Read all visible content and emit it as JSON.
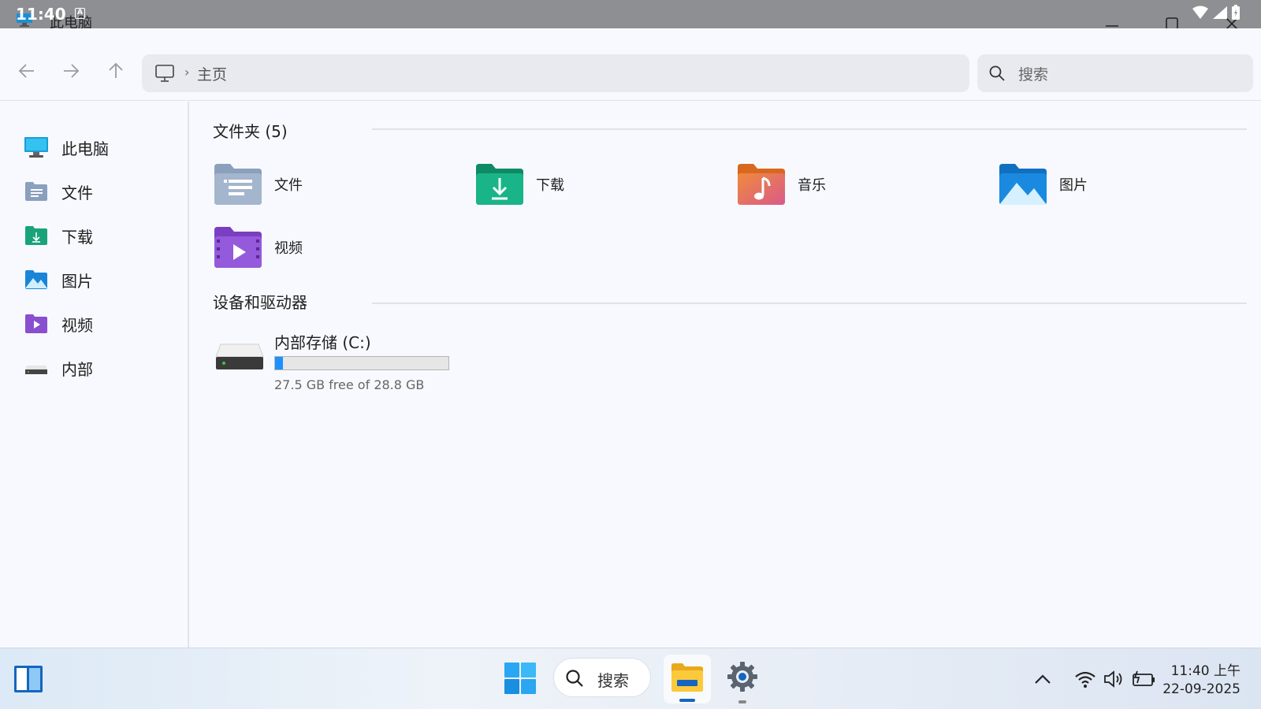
{
  "status_bar": {
    "time": "11:40",
    "notification_letter": "A"
  },
  "window": {
    "title": "此电脑"
  },
  "address": {
    "separator": "›",
    "path": "主页"
  },
  "search": {
    "placeholder": "搜索"
  },
  "sidebar": {
    "items": [
      {
        "label": "此电脑",
        "icon": "computer-icon"
      },
      {
        "label": "文件",
        "icon": "documents-folder-icon"
      },
      {
        "label": "下载",
        "icon": "downloads-folder-icon"
      },
      {
        "label": "图片",
        "icon": "pictures-folder-icon"
      },
      {
        "label": "视频",
        "icon": "videos-folder-icon"
      },
      {
        "label": "内部",
        "icon": "drive-icon"
      }
    ]
  },
  "main": {
    "folders_title": "文件夹 (5)",
    "folders": [
      {
        "label": "文件",
        "icon": "documents-folder-icon",
        "color": "#8aa0bd"
      },
      {
        "label": "下载",
        "icon": "downloads-folder-icon",
        "color": "#19a37a"
      },
      {
        "label": "音乐",
        "icon": "music-folder-icon",
        "color": "#e8703a"
      },
      {
        "label": "图片",
        "icon": "pictures-folder-icon",
        "color": "#1a85d6"
      },
      {
        "label": "视频",
        "icon": "videos-folder-icon",
        "color": "#8a4fd0"
      }
    ],
    "devices_title": "设备和驱动器",
    "drive": {
      "name": "内部存储 (C:)",
      "free_text": "27.5 GB free of 28.8 GB",
      "used_fraction": 0.045
    }
  },
  "taskbar": {
    "search_label": "搜索",
    "time": "11:40 上午",
    "date": "22-09-2025"
  }
}
